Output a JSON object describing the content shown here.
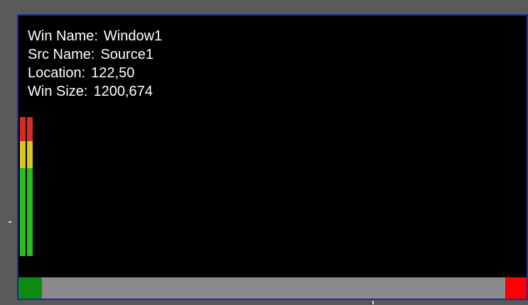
{
  "window_info": {
    "win_name_label": "Win Name:",
    "win_name_value": "Window1",
    "src_name_label": "Src Name:",
    "src_name_value": "Source1",
    "location_label": "Location:",
    "location_value": "122,50",
    "win_size_label": "Win Size:",
    "win_size_value": "1200,674"
  },
  "colors": {
    "frame_border": "#1f2aa8",
    "background": "#000000",
    "vu_red": "#d92b20",
    "vu_yellow": "#d9c81e",
    "vu_green": "#22c024",
    "bottom_bar": "#8a8a8a",
    "bottom_left_block": "#0d8a12",
    "bottom_right_block": "#ff0000"
  }
}
